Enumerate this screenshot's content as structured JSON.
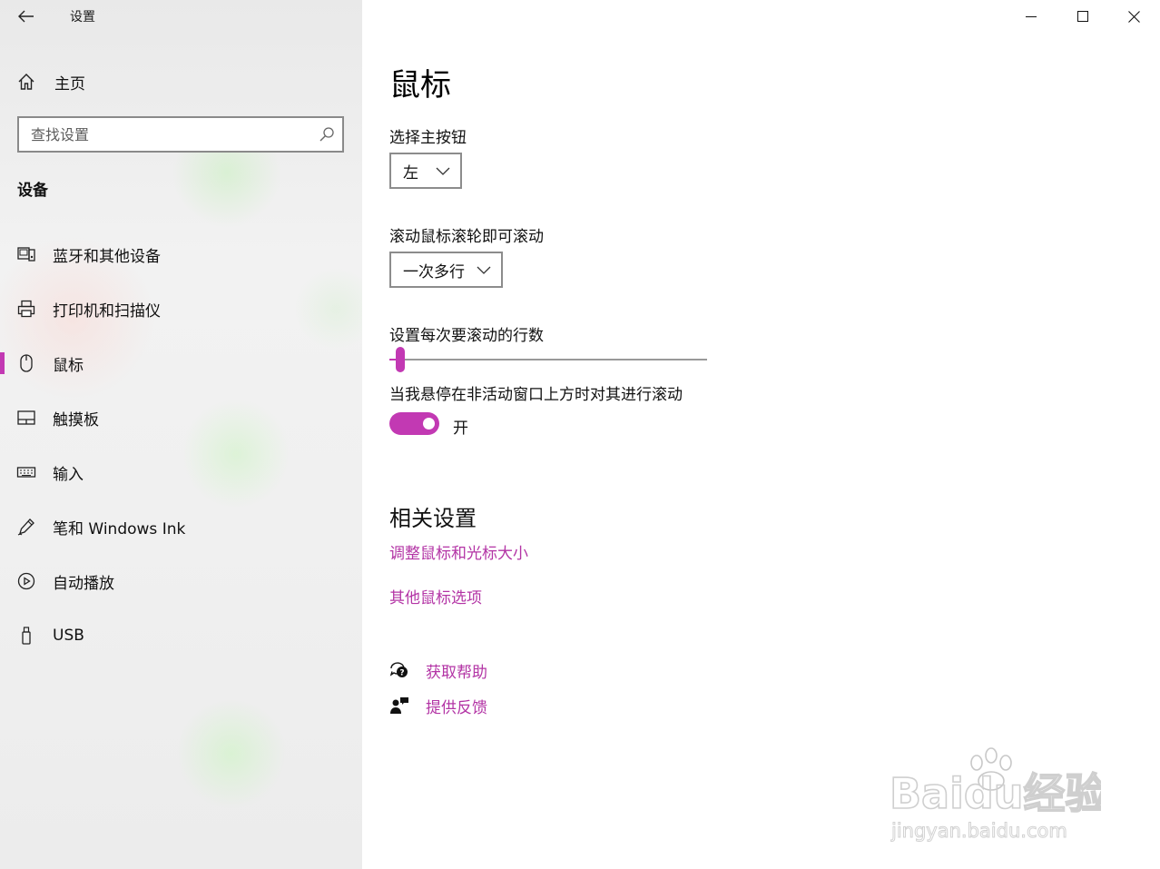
{
  "window": {
    "title": "设置",
    "controls": {
      "minimize": "minimize",
      "maximize": "maximize",
      "close": "close"
    }
  },
  "sidebar": {
    "home_label": "主页",
    "search": {
      "placeholder": "查找设置",
      "value": ""
    },
    "section_title": "设备",
    "items": [
      {
        "label": "蓝牙和其他设备",
        "icon": "bluetooth-devices-icon",
        "active": false
      },
      {
        "label": "打印机和扫描仪",
        "icon": "printer-icon",
        "active": false
      },
      {
        "label": "鼠标",
        "icon": "mouse-icon",
        "active": true
      },
      {
        "label": "触摸板",
        "icon": "touchpad-icon",
        "active": false
      },
      {
        "label": "输入",
        "icon": "keyboard-icon",
        "active": false
      },
      {
        "label": "笔和 Windows Ink",
        "icon": "pen-icon",
        "active": false
      },
      {
        "label": "自动播放",
        "icon": "autoplay-icon",
        "active": false
      },
      {
        "label": "USB",
        "icon": "usb-icon",
        "active": false
      }
    ]
  },
  "main": {
    "title": "鼠标",
    "primary_button": {
      "label": "选择主按钮",
      "value": "左"
    },
    "scroll_mode": {
      "label": "滚动鼠标滚轮即可滚动",
      "value": "一次多行"
    },
    "scroll_lines": {
      "label": "设置每次要滚动的行数",
      "value_fraction": 0.03
    },
    "inactive_scroll": {
      "label": "当我悬停在非活动窗口上方时对其进行滚动",
      "state": "开",
      "on": true
    },
    "related": {
      "title": "相关设置",
      "links": [
        "调整鼠标和光标大小",
        "其他鼠标选项"
      ]
    },
    "help": {
      "get_help": "获取帮助",
      "feedback": "提供反馈"
    }
  },
  "watermark": {
    "text": "Baidu经验",
    "sub": "jingyan.baidu.com"
  },
  "colors": {
    "accent": "#c239b3",
    "link": "#b334a5"
  }
}
